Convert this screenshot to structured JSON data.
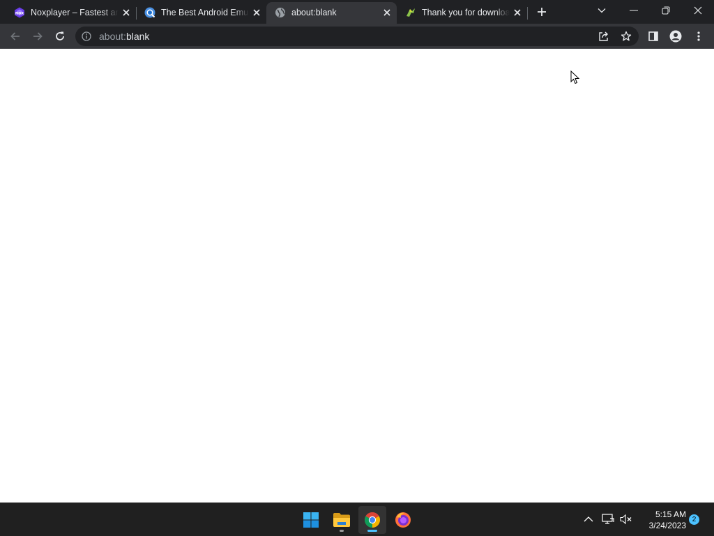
{
  "browser": {
    "tabs": [
      {
        "title": "Noxplayer – Fastest and",
        "favicon": "noxplayer-icon",
        "active": false
      },
      {
        "title": "The Best Android Emulator",
        "favicon": "emulator-site-icon",
        "active": false
      },
      {
        "title": "about:blank",
        "favicon": "globe-icon",
        "active": true
      },
      {
        "title": "Thank you for downloading",
        "favicon": "download-site-icon",
        "active": false
      }
    ],
    "new_tab_icon": "plus-icon",
    "window_controls": [
      "tab-search-icon",
      "minimize-icon",
      "restore-icon",
      "close-icon"
    ]
  },
  "toolbar": {
    "back_icon": "back-arrow-icon",
    "forward_icon": "forward-arrow-icon",
    "reload_icon": "reload-icon",
    "info_icon": "info-icon",
    "url_scheme": "about:",
    "url_rest": "blank",
    "share_icon": "share-icon",
    "bookmark_icon": "star-icon",
    "side_panel_icon": "side-panel-icon",
    "profile_icon": "profile-icon",
    "menu_icon": "kebab-menu-icon"
  },
  "taskbar": {
    "apps": [
      {
        "name": "Start",
        "icon": "windows-start-icon"
      },
      {
        "name": "File Explorer",
        "icon": "file-explorer-icon"
      },
      {
        "name": "Google Chrome",
        "icon": "chrome-icon"
      },
      {
        "name": "Firefox",
        "icon": "firefox-icon"
      }
    ],
    "tray_icons": [
      "chevron-up-icon",
      "network-icon",
      "volume-muted-icon"
    ],
    "time": "5:15 AM",
    "date": "3/24/2023",
    "notification_count": "2"
  },
  "colors": {
    "tabstrip_bg": "#202124",
    "toolbar_bg": "#35363a",
    "omnibox_bg": "#202124",
    "taskbar_bg": "#202020",
    "accent": "#4cc2ff"
  }
}
